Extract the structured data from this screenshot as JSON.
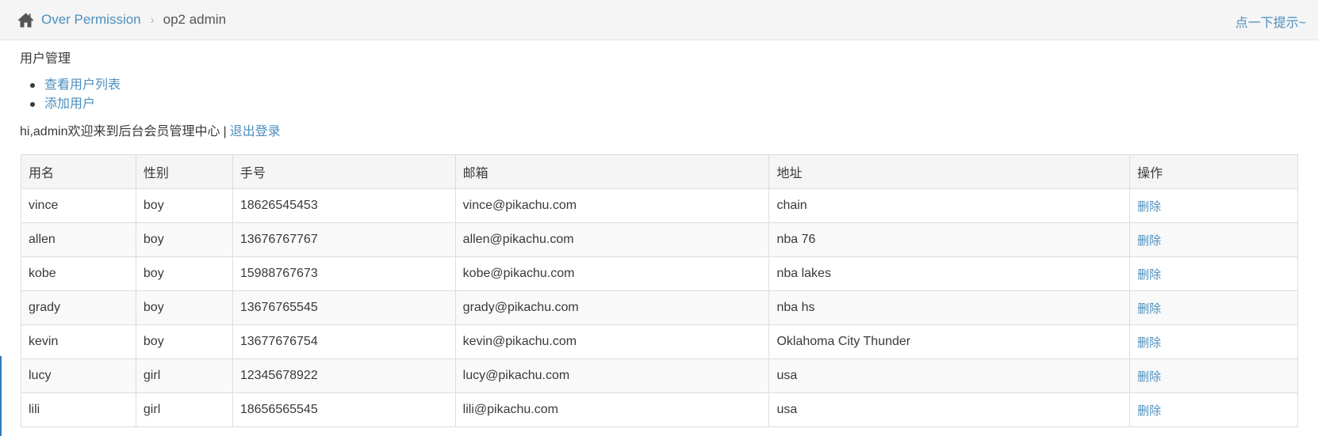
{
  "breadcrumb": {
    "home_icon": "home-icon",
    "parent": "Over Permission",
    "separator": "›",
    "current": "op2 admin"
  },
  "tip_link": "点一下提示~",
  "section_title": "用户管理",
  "menu": [
    {
      "label": "查看用户列表"
    },
    {
      "label": "添加用户"
    }
  ],
  "welcome": {
    "text": "hi,admin欢迎来到后台会员管理中心",
    "separator": "|",
    "logout": "退出登录"
  },
  "table": {
    "headers": [
      "用名",
      "性别",
      "手号",
      "邮箱",
      "地址",
      "操作"
    ],
    "rows": [
      {
        "name": "vince",
        "sex": "boy",
        "phone": "18626545453",
        "email": "vince@pikachu.com",
        "address": "chain",
        "action": "删除"
      },
      {
        "name": "allen",
        "sex": "boy",
        "phone": "13676767767",
        "email": "allen@pikachu.com",
        "address": "nba 76",
        "action": "删除"
      },
      {
        "name": "kobe",
        "sex": "boy",
        "phone": "15988767673",
        "email": "kobe@pikachu.com",
        "address": "nba lakes",
        "action": "删除"
      },
      {
        "name": "grady",
        "sex": "boy",
        "phone": "13676765545",
        "email": "grady@pikachu.com",
        "address": "nba hs",
        "action": "删除"
      },
      {
        "name": "kevin",
        "sex": "boy",
        "phone": "13677676754",
        "email": "kevin@pikachu.com",
        "address": "Oklahoma City Thunder",
        "action": "删除"
      },
      {
        "name": "lucy",
        "sex": "girl",
        "phone": "12345678922",
        "email": "lucy@pikachu.com",
        "address": "usa",
        "action": "删除"
      },
      {
        "name": "lili",
        "sex": "girl",
        "phone": "18656565545",
        "email": "lili@pikachu.com",
        "address": "usa",
        "action": "删除"
      }
    ]
  },
  "colors": {
    "link": "#4c8fbd",
    "text": "#393939",
    "header_bg": "#f5f5f5",
    "border": "#dddddd"
  }
}
